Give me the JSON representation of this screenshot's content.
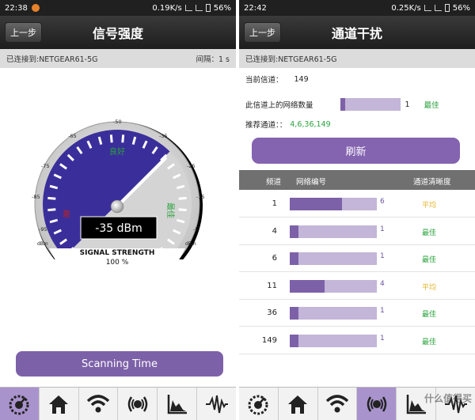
{
  "left": {
    "status": {
      "time": "22:38",
      "speed": "0.19K/s",
      "battery": "56%"
    },
    "title": "信号强度",
    "back_label": "上一步",
    "connected": "已连接到:NETGEAR61-5G",
    "interval": "间隔：1 s",
    "gauge": {
      "reading": "-35 dBm",
      "caption": "SIGNAL STRENGTH",
      "percent": "100 %",
      "ticks": [
        "-95",
        "-85",
        "-75",
        "-65",
        "-50",
        "-35",
        "-25",
        "-15",
        "-5"
      ],
      "unit": "dBm",
      "zone_good": "良好",
      "zone_best": "最佳",
      "zone_poor": "差",
      "value_dbm": -35,
      "colors": {
        "weak_zone": "#3a2f9a",
        "strong_zone": "#d4d4d4",
        "needle": "#ffffff"
      }
    },
    "scan_label": "Scanning Time"
  },
  "right": {
    "status": {
      "time": "22:42",
      "speed": "0.25K/s",
      "battery": "56%"
    },
    "title": "通道干扰",
    "back_label": "上一步",
    "connected": "已连接到:NETGEAR61-5G",
    "current_channel_label": "当前信道：",
    "current_channel_value": "149",
    "networks_label": "此信道上的网络数量",
    "networks_count": "1",
    "networks_fraction": 0.08,
    "networks_rating": "最佳",
    "recommend_label": "推荐通道：：",
    "recommend_value": "4,6,36,149",
    "refresh_label": "刷新",
    "table_headers": {
      "channel": "频道",
      "network": "网络编号",
      "clarity": "通道清晰度"
    },
    "rows": [
      {
        "channel": "1",
        "count": "6",
        "fill": 0.6,
        "clarity": "平均",
        "level": "avg"
      },
      {
        "channel": "4",
        "count": "1",
        "fill": 0.1,
        "clarity": "最佳",
        "level": "best"
      },
      {
        "channel": "6",
        "count": "1",
        "fill": 0.1,
        "clarity": "最佳",
        "level": "best"
      },
      {
        "channel": "11",
        "count": "4",
        "fill": 0.4,
        "clarity": "平均",
        "level": "avg"
      },
      {
        "channel": "36",
        "count": "1",
        "fill": 0.1,
        "clarity": "最佳",
        "level": "best"
      },
      {
        "channel": "149",
        "count": "1",
        "fill": 0.1,
        "clarity": "最佳",
        "level": "best"
      }
    ],
    "watermark": "什么值得买"
  },
  "tabs": [
    {
      "icon": "gauge-icon"
    },
    {
      "icon": "home-icon"
    },
    {
      "icon": "wifi-icon"
    },
    {
      "icon": "radar-icon"
    },
    {
      "icon": "graph-icon"
    },
    {
      "icon": "waveform-icon"
    }
  ],
  "active_tab_left": 0,
  "active_tab_right": 3,
  "accent_color": "#7d61a8"
}
